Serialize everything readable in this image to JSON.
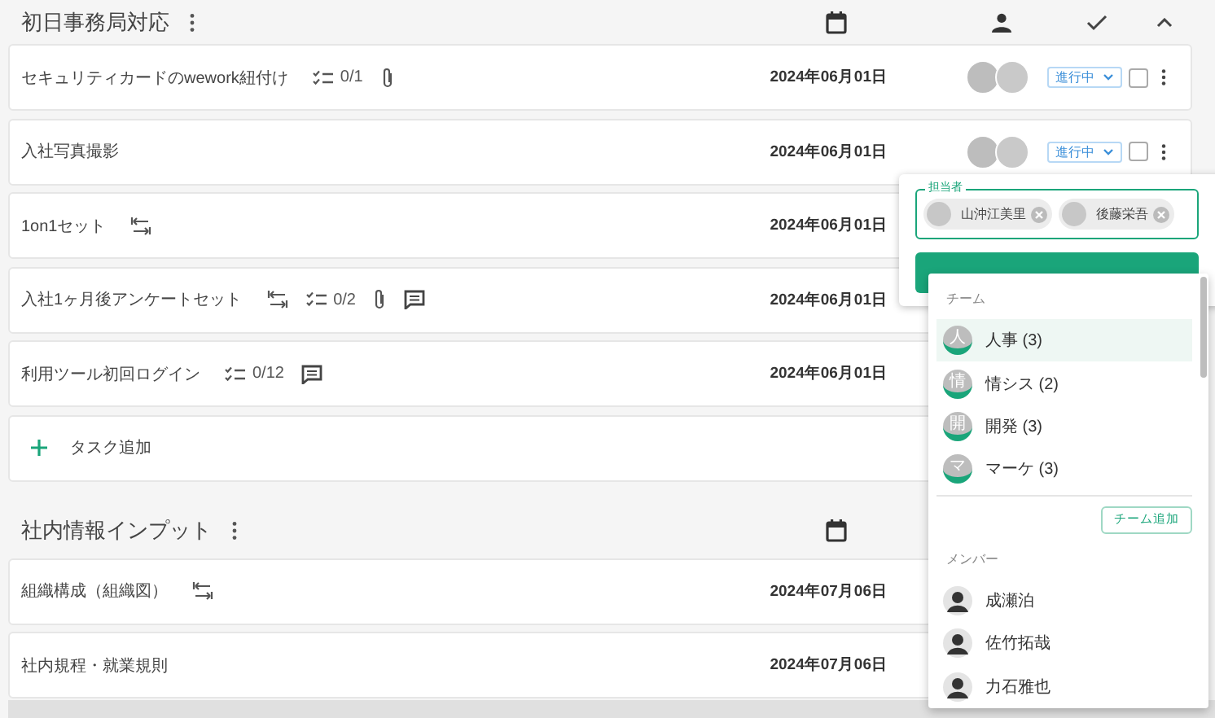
{
  "sections": [
    {
      "title": "初日事務局対応",
      "header_icons": [
        {
          "kind": "calendar"
        },
        {
          "kind": "person"
        },
        {
          "kind": "check"
        },
        {
          "kind": "caret-up"
        }
      ],
      "rows": [
        {
          "kind": "task",
          "title": "セキュリティカードのwework紐付け",
          "meta": [
            {
              "kind": "checklist",
              "text": "0/1"
            },
            {
              "kind": "attachment"
            }
          ],
          "date": "2024年06月01日",
          "assignees": [
            {
              "kind": "photo"
            },
            {
              "kind": "photo"
            }
          ],
          "status": "進行中",
          "done": false
        },
        {
          "kind": "task",
          "title": "入社写真撮影",
          "meta": [],
          "date": "2024年06月01日",
          "assignees": [
            {
              "kind": "photo"
            },
            {
              "kind": "photo"
            }
          ],
          "status": "進行中",
          "done": false
        },
        {
          "kind": "task",
          "title": "1on1セット",
          "meta": [
            {
              "kind": "dependency"
            }
          ],
          "date": "2024年06月01日"
        },
        {
          "kind": "task",
          "title": "入社1ヶ月後アンケートセット",
          "meta": [
            {
              "kind": "dependency"
            },
            {
              "kind": "checklist",
              "text": "0/2"
            },
            {
              "kind": "attachment"
            },
            {
              "kind": "comment"
            }
          ],
          "date": "2024年06月01日"
        },
        {
          "kind": "task",
          "title": "利用ツール初回ログイン",
          "meta": [
            {
              "kind": "checklist",
              "text": "0/12"
            },
            {
              "kind": "comment"
            }
          ],
          "date": "2024年06月01日"
        },
        {
          "kind": "add",
          "title": "タスク追加"
        }
      ]
    },
    {
      "title": "社内情報インプット",
      "header_icons": [
        {
          "kind": "calendar"
        }
      ],
      "rows": [
        {
          "kind": "task",
          "title": "組織構成（組織図）",
          "meta": [
            {
              "kind": "dependency"
            }
          ],
          "date": "2024年07月06日"
        },
        {
          "kind": "task",
          "title": "社内規程・就業規則",
          "meta": [],
          "date": "2024年07月06日"
        }
      ]
    }
  ],
  "assignee_popup": {
    "label": "担当者",
    "chips": [
      {
        "name": "山沖江美里"
      },
      {
        "name": "後藤栄吾"
      }
    ],
    "dropdown": {
      "team_heading": "チーム",
      "teams": [
        {
          "avatar_text": "人",
          "name": "人事 (3)",
          "selected": true
        },
        {
          "avatar_text": "情",
          "name": "情シス (2)",
          "selected": false
        },
        {
          "avatar_text": "開",
          "name": "開発 (3)",
          "selected": false
        },
        {
          "avatar_text": "マ",
          "name": "マーケ (3)",
          "selected": false
        }
      ],
      "add_team_button": "チーム追加",
      "member_heading": "メンバー",
      "members": [
        {
          "name": "成瀬泊",
          "selected": false
        },
        {
          "name": "佐竹拓哉",
          "selected": false
        },
        {
          "name": "力石雅也",
          "selected": false
        }
      ]
    }
  }
}
